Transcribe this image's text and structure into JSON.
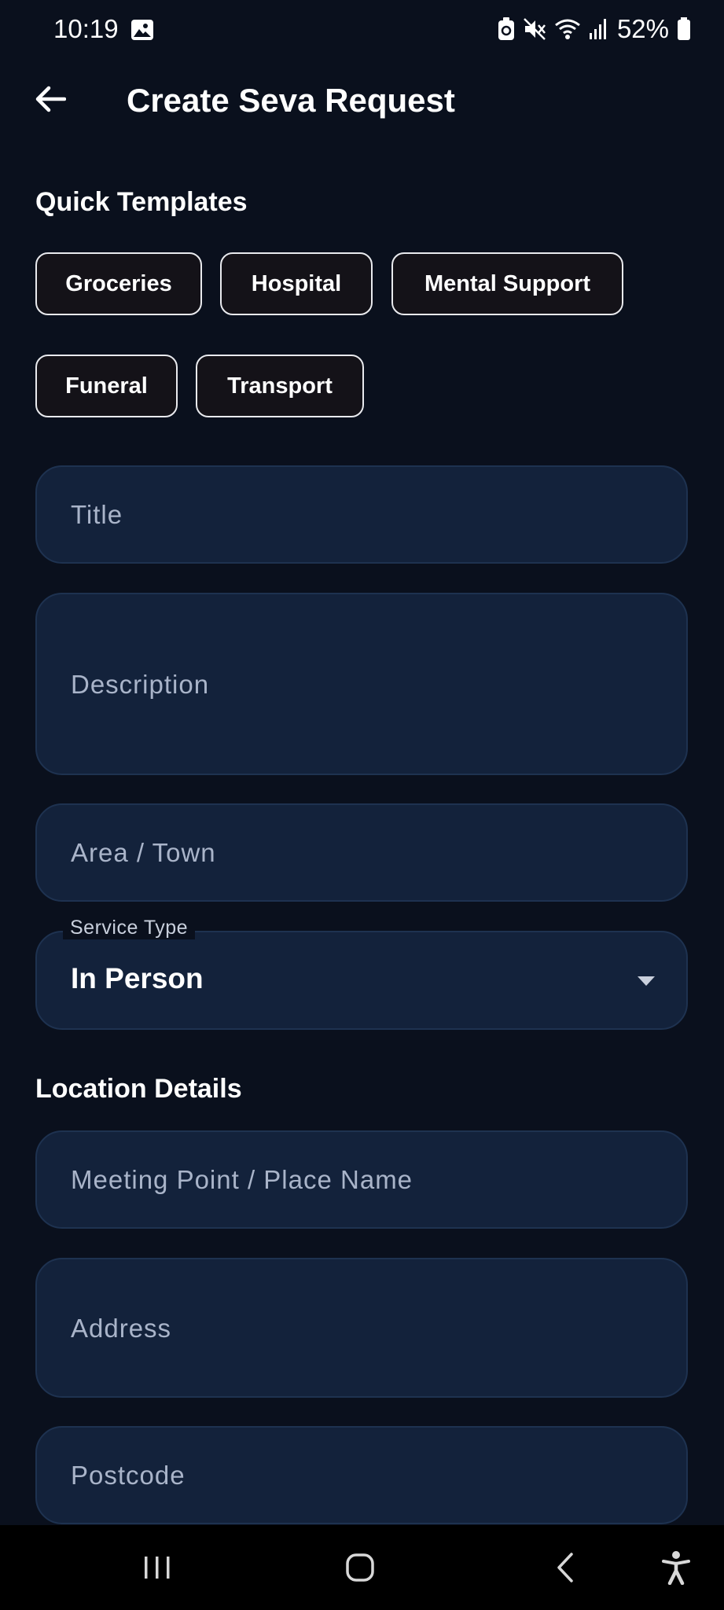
{
  "status_bar": {
    "time": "10:19",
    "battery": "52%",
    "icons": [
      "image-icon",
      "battery-saver-icon",
      "mute-icon",
      "wifi-icon",
      "signal-icon",
      "battery-icon"
    ]
  },
  "app_bar": {
    "back_icon": "arrow-left-icon",
    "title": "Create Seva Request"
  },
  "quick_templates": {
    "heading": "Quick Templates",
    "chips": [
      "Groceries",
      "Hospital",
      "Mental Support",
      "Funeral",
      "Transport"
    ]
  },
  "form": {
    "title_placeholder": "Title",
    "description_placeholder": "Description",
    "area_placeholder": "Area / Town",
    "service_type": {
      "label": "Service Type",
      "value": "In Person",
      "icon": "dropdown-arrow-icon"
    }
  },
  "location": {
    "heading": "Location Details",
    "meeting_point_placeholder": "Meeting Point / Place Name",
    "address_placeholder": "Address",
    "postcode_placeholder": "Postcode"
  },
  "nav_bar": {
    "icons": [
      "recents-icon",
      "home-icon",
      "back-icon",
      "accessibility-icon"
    ]
  },
  "colors": {
    "background": "#0a101d",
    "field": "#13223b",
    "chip": "#141218",
    "text": "#ffffff",
    "placeholder": "#a9b4c9"
  }
}
